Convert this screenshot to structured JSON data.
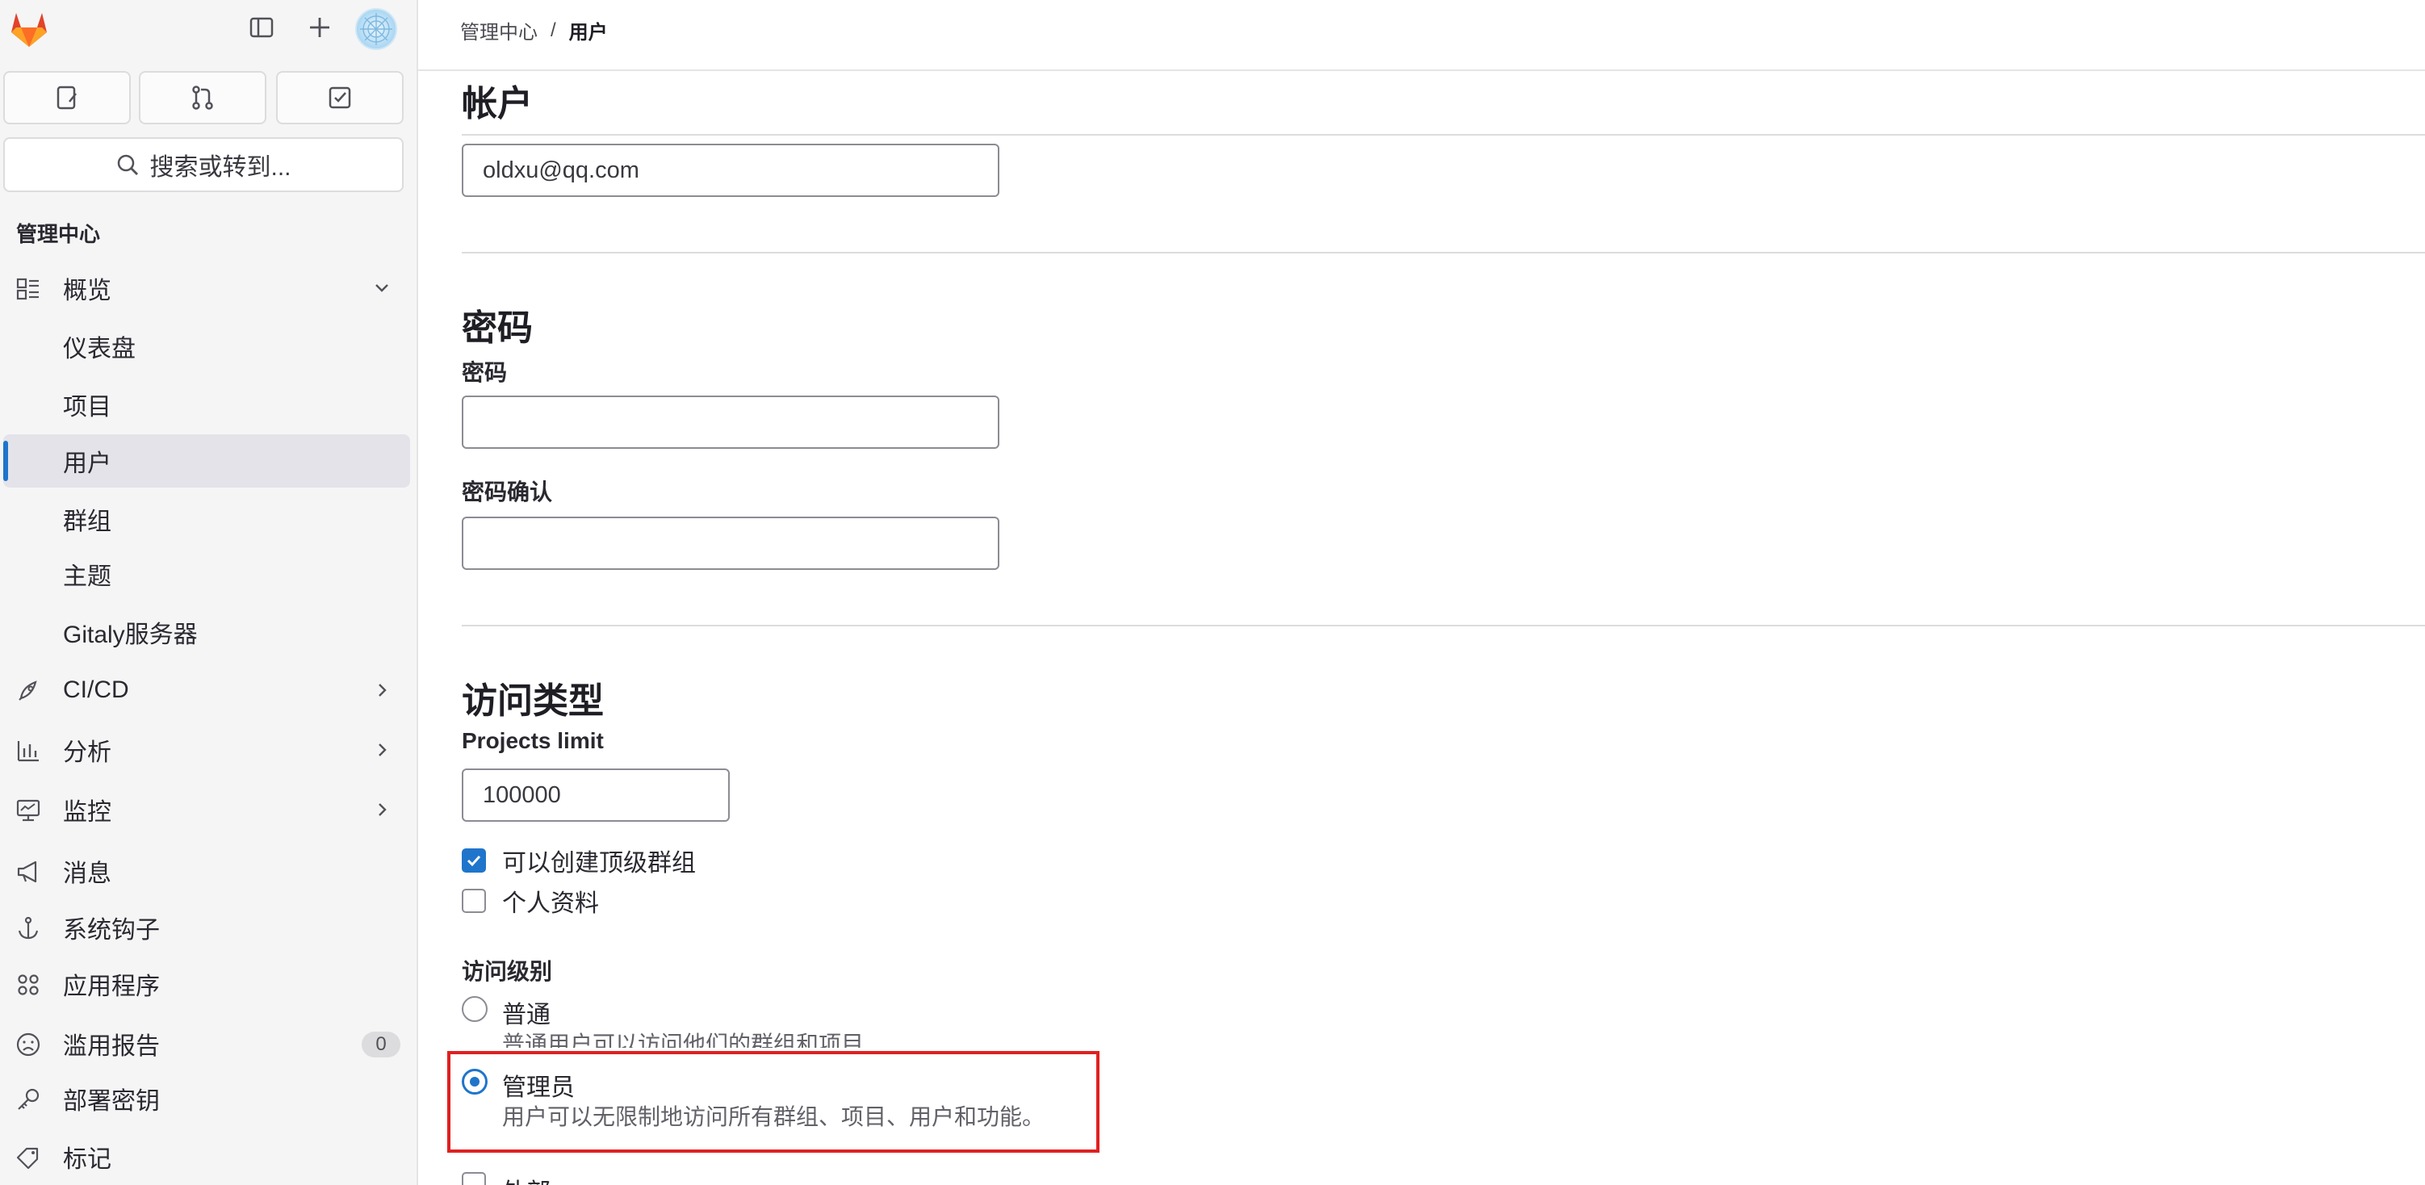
{
  "sidebar": {
    "search_label": "搜索或转到...",
    "section_title": "管理中心",
    "items": [
      {
        "label": "概览"
      },
      {
        "label": "仪表盘"
      },
      {
        "label": "项目"
      },
      {
        "label": "用户"
      },
      {
        "label": "群组"
      },
      {
        "label": "主题"
      },
      {
        "label": "Gitaly服务器"
      },
      {
        "label": "CI/CD"
      },
      {
        "label": "分析"
      },
      {
        "label": "监控"
      },
      {
        "label": "消息"
      },
      {
        "label": "系统钩子"
      },
      {
        "label": "应用程序"
      },
      {
        "label": "滥用报告",
        "badge": "0"
      },
      {
        "label": "部署密钥"
      },
      {
        "label": "标记"
      }
    ]
  },
  "breadcrumb": {
    "parent": "管理中心",
    "separator": "/",
    "current": "用户"
  },
  "account": {
    "heading": "帐户",
    "email_value": "oldxu@qq.com"
  },
  "password": {
    "heading": "密码",
    "password_label": "密码",
    "confirm_label": "密码确认"
  },
  "access": {
    "heading": "访问类型",
    "projects_limit_label": "Projects limit",
    "projects_limit_value": "100000",
    "can_create_group_label": "可以创建顶级群组",
    "can_create_group_checked": true,
    "private_profile_label": "个人资料",
    "private_profile_checked": false,
    "level_label": "访问级别",
    "levels": [
      {
        "title": "普通",
        "desc": "普通用户可以访问他们的群组和项目",
        "selected": false
      },
      {
        "title": "管理员",
        "desc": "用户可以无限制地访问所有群组、项目、用户和功能。",
        "selected": true
      }
    ],
    "external_label": "外部"
  },
  "colors": {
    "accent": "#1f75cb",
    "highlight": "#e02020"
  }
}
